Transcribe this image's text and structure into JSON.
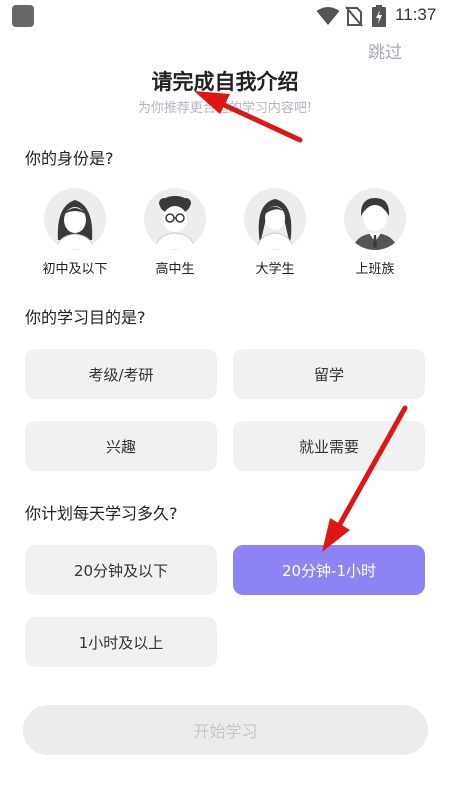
{
  "status_bar": {
    "time": "11:37"
  },
  "header": {
    "skip_label": "跳过",
    "title": "请完成自我介绍",
    "subtitle": "为你推荐更合适的学习内容吧!"
  },
  "identity": {
    "question": "你的身份是?",
    "options": [
      {
        "label": "初中及以下",
        "icon": "girl-avatar-icon"
      },
      {
        "label": "高中生",
        "icon": "boy-glasses-avatar-icon"
      },
      {
        "label": "大学生",
        "icon": "young-woman-avatar-icon"
      },
      {
        "label": "上班族",
        "icon": "man-suit-avatar-icon"
      }
    ]
  },
  "purpose": {
    "question": "你的学习目的是?",
    "options": [
      "考级/考研",
      "留学",
      "兴趣",
      "就业需要"
    ]
  },
  "daily_time": {
    "question": "你计划每天学习多久?",
    "options": [
      "20分钟及以下",
      "20分钟-1小时",
      "1小时及以上"
    ],
    "selected": "20分钟-1小时"
  },
  "start_button": {
    "label": "开始学习"
  },
  "colors": {
    "accent": "#8f84f4",
    "option_bg": "#f1f1f1",
    "annotation_arrow": "#e01515"
  }
}
